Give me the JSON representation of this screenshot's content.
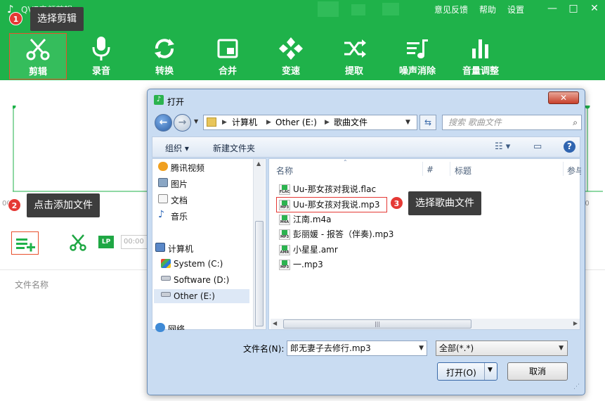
{
  "app": {
    "title": "QVE音频剪辑",
    "top_links": [
      "意见反馈",
      "帮助",
      "设置"
    ],
    "window_controls": [
      "—",
      "□",
      "✕"
    ],
    "tools": [
      {
        "label": "剪辑",
        "icon": "scissors-icon"
      },
      {
        "label": "录音",
        "icon": "microphone-icon"
      },
      {
        "label": "转换",
        "icon": "convert-icon"
      },
      {
        "label": "合并",
        "icon": "merge-icon"
      },
      {
        "label": "变速",
        "icon": "speed-icon"
      },
      {
        "label": "提取",
        "icon": "extract-icon"
      },
      {
        "label": "噪声消除",
        "icon": "noise-removal-icon"
      },
      {
        "label": "音量调整",
        "icon": "volume-icon"
      }
    ],
    "wave_start_time": "00",
    "wave_right_time": "00",
    "lp_badge": "LP",
    "time_placeholder": "00:00",
    "file_name_column": "文件名称",
    "accent_color": "#1fb24a"
  },
  "callouts": [
    {
      "number": "1",
      "text": "选择剪辑"
    },
    {
      "number": "2",
      "text": "点击添加文件"
    },
    {
      "number": "3",
      "text": "选择歌曲文件"
    }
  ],
  "dialog": {
    "title": "打开",
    "close_symbol": "✕",
    "breadcrumb": [
      "计算机",
      "Other (E:)",
      "歌曲文件"
    ],
    "search_placeholder": "搜索 歌曲文件",
    "organize_label": "组织",
    "new_folder_label": "新建文件夹",
    "help_symbol": "?",
    "nav_items": [
      {
        "label": "腾讯视频",
        "icon": "tencent-video-icon"
      },
      {
        "label": "图片",
        "icon": "pictures-icon"
      },
      {
        "label": "文档",
        "icon": "documents-icon"
      },
      {
        "label": "音乐",
        "icon": "music-icon"
      },
      {
        "label": "计算机",
        "icon": "computer-icon"
      },
      {
        "label": "System (C:)",
        "icon": "windows-drive-icon"
      },
      {
        "label": "Software (D:)",
        "icon": "drive-icon"
      },
      {
        "label": "Other (E:)",
        "icon": "drive-icon"
      },
      {
        "label": "网络",
        "icon": "network-icon"
      }
    ],
    "selected_nav": "Other (E:)",
    "columns": [
      "名称",
      "#",
      "标题",
      "参与"
    ],
    "files": [
      {
        "name": "Uu-那女孩对我说.flac",
        "type": "FLAC"
      },
      {
        "name": "Uu-那女孩对我说.mp3",
        "type": "MP3"
      },
      {
        "name": "江南.m4a",
        "type": "M4A"
      },
      {
        "name": "彭丽媛 - 报答（伴奏).mp3",
        "type": "MP3"
      },
      {
        "name": "小星星.amr",
        "type": "AMR"
      },
      {
        "name": "一.mp3",
        "type": "MP3"
      }
    ],
    "highlighted_file": "Uu-那女孩对我说.mp3",
    "filename_label": "文件名(N):",
    "filename_value": "郎无妻子去修行.mp3",
    "filter_value": "全部(*.*)",
    "open_label": "打开(O)",
    "cancel_label": "取消"
  }
}
